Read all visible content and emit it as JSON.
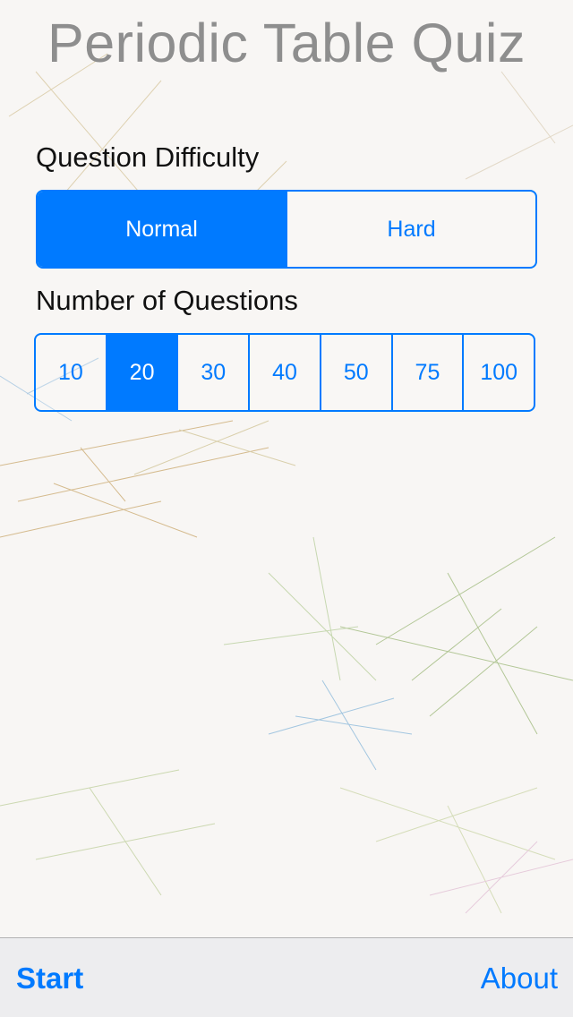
{
  "app": {
    "title": "Periodic Table Quiz"
  },
  "difficulty": {
    "label": "Question Difficulty",
    "options": [
      "Normal",
      "Hard"
    ],
    "selected": "Normal"
  },
  "questions": {
    "label": "Number of Questions",
    "options": [
      "10",
      "20",
      "30",
      "40",
      "50",
      "75",
      "100"
    ],
    "selected": "20"
  },
  "toolbar": {
    "start_label": "Start",
    "about_label": "About"
  },
  "colors": {
    "accent": "#007aff",
    "title": "#8e8e8e",
    "toolbar_bg": "#ececee"
  }
}
